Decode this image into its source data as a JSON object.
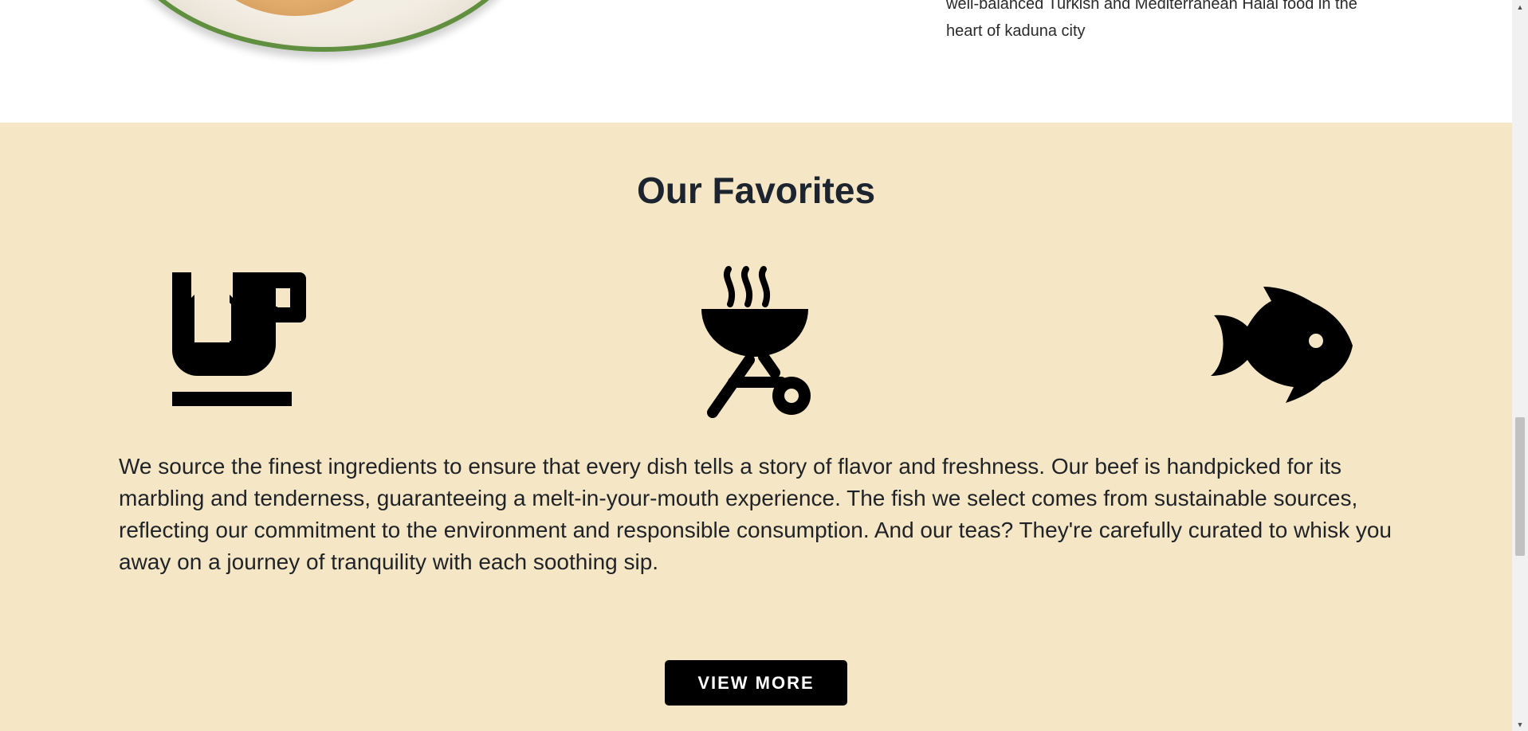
{
  "intro": {
    "text_line1": "well-balanced Turkish and Mediterranean Halal food in the",
    "text_line2": "heart of kaduna city"
  },
  "favorites": {
    "title": "Our Favorites",
    "icons": [
      "tea-cup-icon",
      "grill-icon",
      "fish-icon"
    ],
    "description": "We source the finest ingredients to ensure that every dish tells a story of flavor and freshness. Our beef is handpicked for its marbling and tenderness, guaranteeing a melt-in-your-mouth experience. The fish we select comes from sustainable sources, reflecting our commitment to the environment and responsible consumption. And our teas? They're carefully curated to whisk you away on a journey of tranquility with each soothing sip.",
    "button_label": "VIEW MORE",
    "background_color": "#f5e7c5"
  },
  "scrollbar": {
    "up_arrow": "▲",
    "down_arrow": "▼"
  }
}
